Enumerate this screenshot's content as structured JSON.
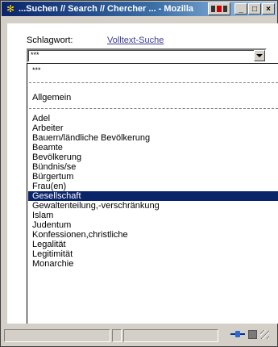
{
  "window": {
    "title": "...Suchen // Search // Chercher ... - Mozilla",
    "app_icon": "mozilla-icon",
    "buttons": {
      "minimize": "_",
      "maximize": "□",
      "close": "×"
    }
  },
  "form": {
    "keyword_label": "Schlagwort:",
    "fulltext_link": "Volltext-Suche",
    "select_value": "***"
  },
  "dropdown": {
    "options_top": [
      "***",
      "Allgemein"
    ],
    "options": [
      "Adel",
      "Arbeiter",
      "Bauern/ländliche Bevölkerung",
      "Beamte",
      "Bevölkerung",
      "Bündnis/se",
      "Bürgertum",
      "Frau(en)",
      "Gesellschaft",
      "Gewaltenteilung,-verschränkung",
      "Islam",
      "Judentum",
      "Konfessionen,christliche",
      "Legalität",
      "Legitimität",
      "Monarchie"
    ],
    "selected": "Gesellschaft"
  },
  "colors": {
    "title_start": "#0a246a",
    "title_end": "#a6caf0",
    "selection": "#0a246a",
    "link": "#3c3c8c"
  },
  "statusbar": {
    "icons": [
      "connection-icon",
      "lock-icon",
      "resize-grip-icon"
    ]
  }
}
